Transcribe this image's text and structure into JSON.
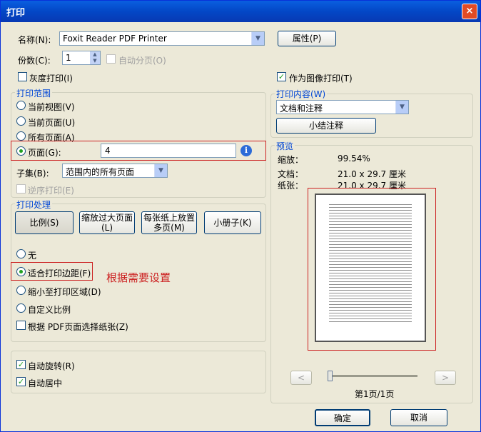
{
  "window": {
    "title": "打印",
    "close": "×"
  },
  "printer": {
    "name_label": "名称(N):",
    "name_value": "Foxit Reader PDF Printer",
    "properties_button": "属性(P)"
  },
  "copies": {
    "label": "份数(C):",
    "value": "1",
    "collate_label": "自动分页(O)"
  },
  "options": {
    "grayscale_label": "灰度打印(I)",
    "grayscale_checked": false,
    "print_as_image_label": "作为图像打印(T)",
    "print_as_image_checked": true
  },
  "range": {
    "title": "打印范围",
    "current_view": "当前视图(V)",
    "current_page": "当前页面(U)",
    "all_pages": "所有页面(A)",
    "pages_label": "页面(G):",
    "pages_value": "4",
    "info_icon": "i",
    "subset_label": "子集(B):",
    "subset_value": "范围内的所有页面",
    "reverse_label": "逆序打印(E)"
  },
  "handling": {
    "title": "打印处理",
    "scale_button": "比例(S)",
    "tile_button_line1": "缩放过大页面",
    "tile_button_line2": "(L)",
    "multiple_button_line1": "每张纸上放置",
    "multiple_button_line2": "多页(M)",
    "booklet_button": "小册子(K)",
    "none_label": "无",
    "fit_margins_label": "适合打印边距(F)",
    "shrink_label": "缩小至打印区域(D)",
    "custom_label": "自定义比例",
    "choose_paper_label": "根据 PDF页面选择纸张(Z)",
    "annotation": "根据需要设置"
  },
  "autorotate": {
    "rotate_label": "自动旋转(R)",
    "rotate_checked": true,
    "center_label": "自动居中",
    "center_checked": true
  },
  "content": {
    "title": "打印内容(W)",
    "value": "文档和注释",
    "summarize_button": "小结注释"
  },
  "preview": {
    "title": "预览",
    "zoom_label": "缩放：",
    "zoom_value": "99.54%",
    "doc_label": "文档：",
    "doc_value": "21.0 x 29.7 厘米",
    "paper_label": "纸张：",
    "paper_value": "21.0 x 29.7 厘米",
    "prev_button": "<",
    "next_button": ">",
    "page_indicator": "第1页/1页"
  },
  "footer": {
    "ok_button": "确定",
    "cancel_button": "取消"
  },
  "colors": {
    "accent": "#0046d5",
    "highlight": "#cc2222",
    "check": "#21a121"
  }
}
